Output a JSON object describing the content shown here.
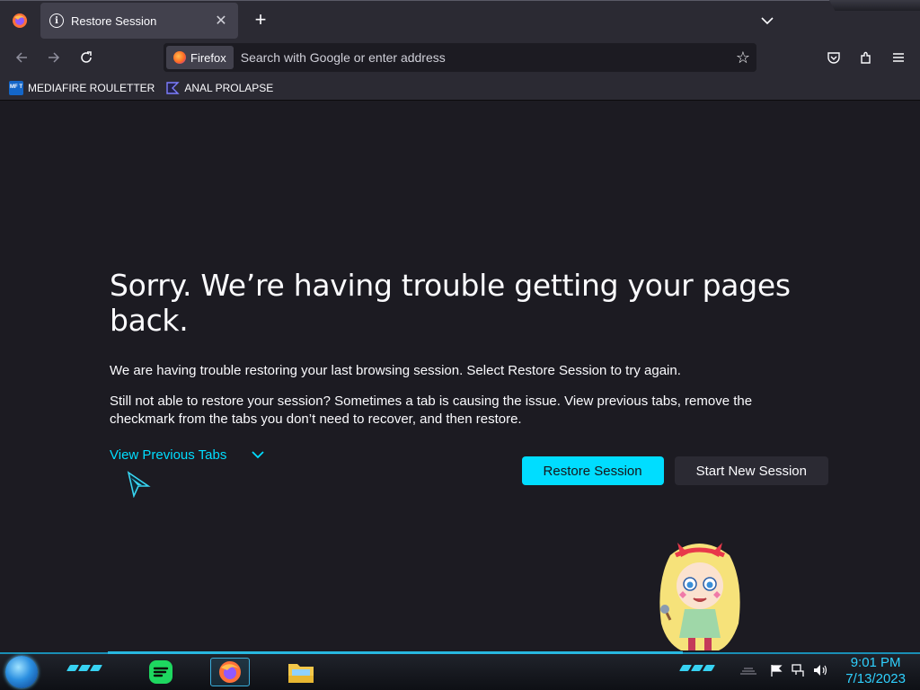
{
  "browser": {
    "tab": {
      "title": "Restore Session",
      "close_glyph": "✕"
    },
    "new_tab_glyph": "+",
    "urlbar": {
      "identity_label": "Firefox",
      "placeholder": "Search with Google or enter address"
    },
    "bookmarks": [
      {
        "label": "MEDIAFIRE ROULETTER",
        "icon": "mediafire-icon",
        "icon_text": "MF T"
      },
      {
        "label": "ANAL PROLAPSE",
        "icon": "sigma-icon"
      }
    ]
  },
  "page": {
    "title": "Sorry. We’re having trouble getting your pages back.",
    "paragraph1": "We are having trouble restoring your last browsing session. Select Restore Session to try again.",
    "paragraph2": "Still not able to restore your session? Sometimes a tab is causing the issue. View previous tabs, remove the checkmark from the tabs you don’t need to recover, and then restore.",
    "view_previous_tabs": "View Previous Tabs",
    "restore_button": "Restore Session",
    "new_session_button": "Start New Session"
  },
  "taskbar": {
    "apps": [
      "start-orb",
      "spotify",
      "firefox",
      "file-explorer"
    ],
    "time": "9:01 PM",
    "date": "7/13/2023"
  },
  "colors": {
    "accent": "#00ddff",
    "background": "#1c1b22",
    "toolbar": "#2b2a33",
    "taskbar_accent": "#2fd1ff"
  }
}
